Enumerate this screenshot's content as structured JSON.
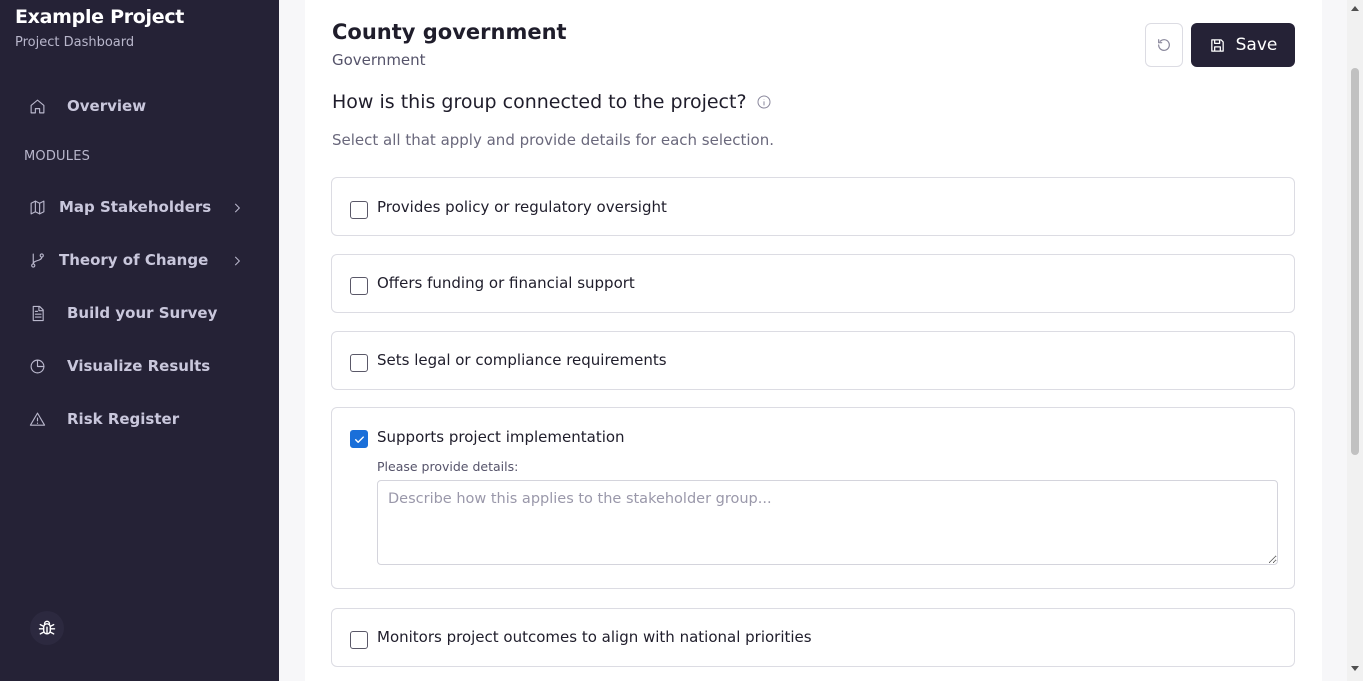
{
  "sidebar": {
    "brand_title": "Example Project",
    "brand_subtitle": "Project Dashboard",
    "overview": "Overview",
    "section_label": "MODULES",
    "items": [
      {
        "label": "Map Stakeholders",
        "icon": "map-icon",
        "has_chevron": true
      },
      {
        "label": "Theory of Change",
        "icon": "git-branch-icon",
        "has_chevron": true
      },
      {
        "label": "Build your Survey",
        "icon": "document-icon",
        "has_chevron": false
      },
      {
        "label": "Visualize Results",
        "icon": "pie-chart-icon",
        "has_chevron": false
      },
      {
        "label": "Risk Register",
        "icon": "warning-icon",
        "has_chevron": false
      }
    ],
    "debug_icon": "bug-icon"
  },
  "header": {
    "title": "County government",
    "subtitle": "Government",
    "save_label": "Save"
  },
  "question": {
    "text": "How is this group connected to the project?",
    "hint": "Select all that apply and provide details for each selection."
  },
  "options": [
    {
      "label": "Provides policy or regulatory oversight",
      "checked": false
    },
    {
      "label": "Offers funding or financial support",
      "checked": false
    },
    {
      "label": "Sets legal or compliance requirements",
      "checked": false
    },
    {
      "label": "Supports project implementation",
      "checked": true,
      "details_label": "Please provide details:",
      "details_placeholder": "Describe how this applies to the stakeholder group...",
      "details_value": ""
    },
    {
      "label": "Monitors project outcomes to align with national priorities",
      "checked": false
    }
  ],
  "colors": {
    "sidebar_bg": "#252236",
    "primary_button": "#252236",
    "checkbox_checked": "#1a6fd9"
  }
}
